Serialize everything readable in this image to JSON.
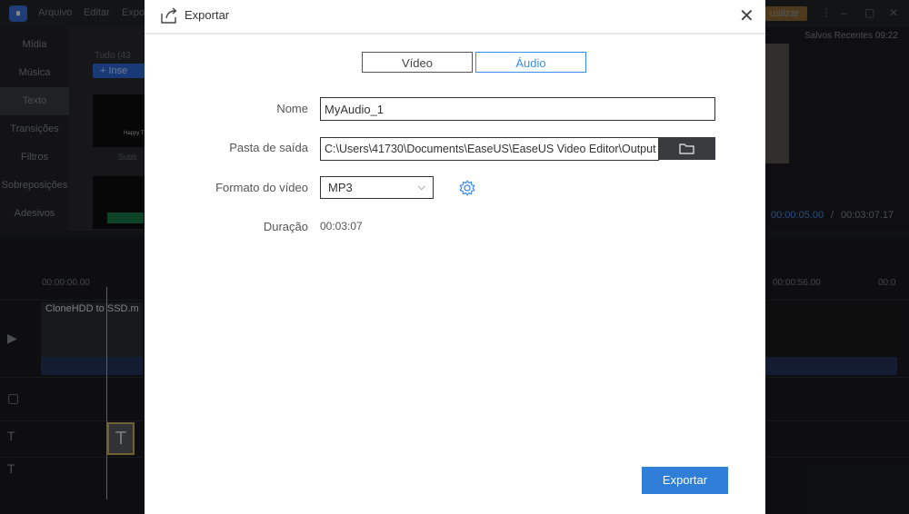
{
  "app": {
    "menu": [
      "Arquivo",
      "Editar",
      "Expo"
    ],
    "upgrade_label": "ualizar",
    "saved_text": "Salvos Recentes 09:22"
  },
  "sidebar": {
    "items": [
      "Mídia",
      "Música",
      "Texto",
      "Transições",
      "Filtros",
      "Sobreposições",
      "Adesivos"
    ]
  },
  "library": {
    "tab_label": "Tudo (43",
    "insert_label": "Inse",
    "thumb_caption": "Happy T",
    "subtitle_caption": "Subti"
  },
  "preview": {
    "current_time": "00:00:05.00",
    "separator": "/",
    "total_time": "00:03:07.17"
  },
  "timeline": {
    "ruler_start": "00:00:00.00",
    "ruler_mid": "00:00:56.00",
    "ruler_end": "00:0",
    "clip_name": "CloneHDD to SSD.m"
  },
  "dialog": {
    "title": "Exportar",
    "tabs": [
      {
        "label": "Vídeo",
        "active": false
      },
      {
        "label": "Áudio",
        "active": true
      }
    ],
    "name_label": "Nome",
    "name_value": "MyAudio_1",
    "output_label": "Pasta de saída",
    "output_value": "C:\\Users\\41730\\Documents\\EaseUS\\EaseUS Video Editor\\Output",
    "format_label": "Formato do vídeo",
    "format_value": "MP3",
    "duration_label": "Duração",
    "duration_value": "00:03:07",
    "export_label": "Exportar",
    "accent_color": "#2f7fd8"
  }
}
